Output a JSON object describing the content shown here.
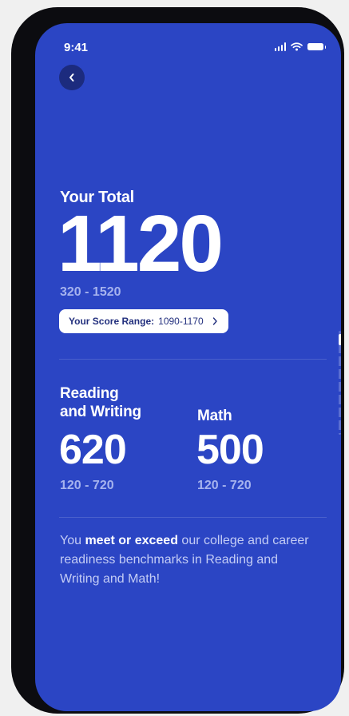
{
  "status_bar": {
    "time": "9:41"
  },
  "total": {
    "label": "Your Total",
    "score": "1120",
    "range": "320 - 1520",
    "score_range_label": "Your Score Range:",
    "score_range_value": "1090-1170"
  },
  "sections": [
    {
      "title_line1": "Reading",
      "title_line2": "and Writing",
      "score": "620",
      "range": "120 - 720"
    },
    {
      "title_line1": "Math",
      "score": "500",
      "range": "120 - 720"
    }
  ],
  "message": {
    "part1": "You ",
    "bold": "meet or exceed",
    "part2": " our college and career readiness benchmarks in Reading and Writing and Math!"
  },
  "colors": {
    "background": "#2b45c4",
    "back_button": "#1c2b7e",
    "muted_text": "#a6b3ee",
    "pill_text": "#23307e"
  },
  "icons": {
    "back": "chevron-left-icon",
    "range_chevron": "chevron-right-icon",
    "signal": "signal-icon",
    "wifi": "wifi-icon",
    "battery": "battery-icon"
  }
}
